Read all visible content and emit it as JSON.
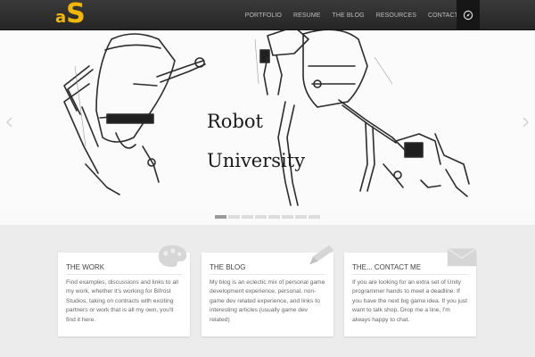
{
  "logo": {
    "text_a": "a",
    "text_s": "S"
  },
  "nav": {
    "items": [
      "PORTFOLIO",
      "RESUME",
      "THE BLOG",
      "RESOURCES",
      "CONTACT"
    ],
    "search_icon": "compass-search-icon"
  },
  "slider": {
    "line1": "Robot",
    "line2": "University",
    "dots": 8,
    "active_dot": 0
  },
  "cards": [
    {
      "title": "THE WORK",
      "body": "Find examples, discussions and links to all my work, whether it's working for Bifrost Studios, taking on contracts with exciting partners or work that is all my own, you'll find it here.",
      "icon": "palette-icon"
    },
    {
      "title": "THE BLOG",
      "body": "My blog is an eclectic mix of personal game development experience, personal, non-game dev related experience, and links to interesting articles (usually game dev related)",
      "icon": "pencil-icon"
    },
    {
      "title": "THE... CONTACT ME",
      "body": "If you are looking for an extra set of Unity programmer hands to meet a deadline. If you have the next big game idea. If you just want to talk shop. Drop me a line, I'm always happy to chat.",
      "icon": "envelope-icon"
    }
  ],
  "colors": {
    "accent": "#f2b705",
    "header": "#2e2e2e",
    "background": "#ececec"
  }
}
